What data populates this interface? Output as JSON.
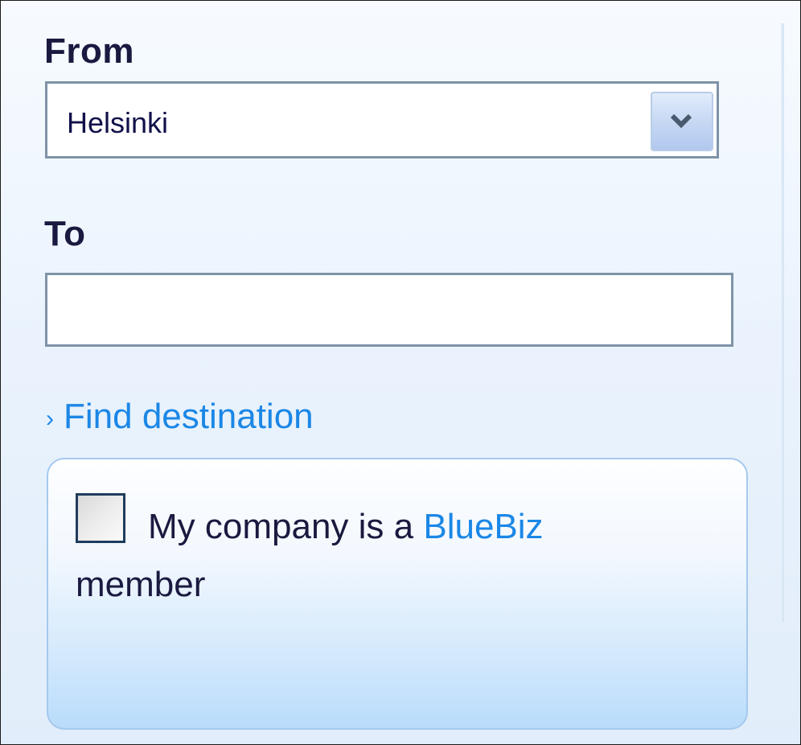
{
  "form": {
    "from_label": "From",
    "from_value": "Helsinki",
    "to_label": "To",
    "to_value": "",
    "find_destination_arrow": "›",
    "find_destination_label": "Find destination",
    "bluebiz": {
      "text_before": "My company is a",
      "link": "BlueBiz",
      "text_after": "member",
      "checked": false
    }
  },
  "icons": {
    "dropdown": "chevron-down-icon"
  },
  "colors": {
    "link": "#1b87e6",
    "label": "#1a1a40",
    "field_border": "#7f93a8",
    "box_border": "#a5c9ee"
  }
}
